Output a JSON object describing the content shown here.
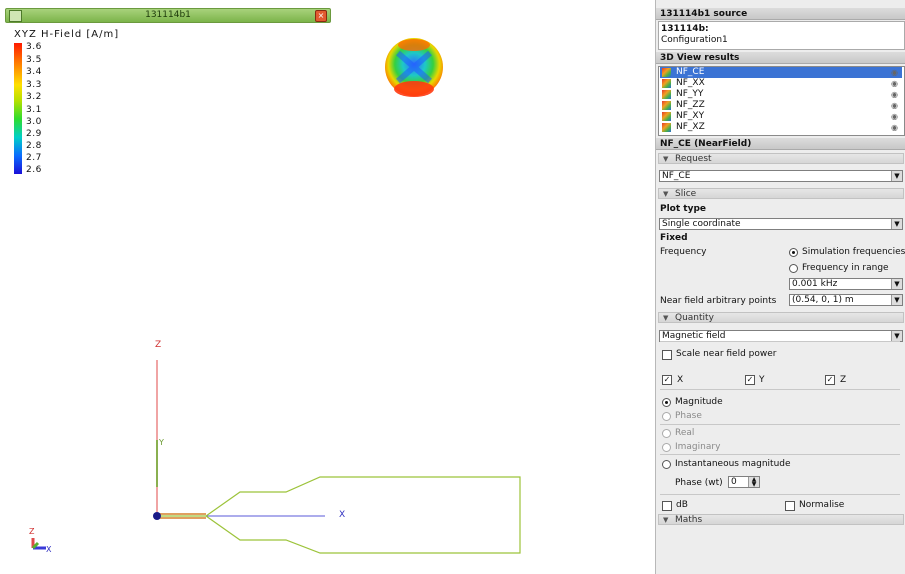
{
  "window": {
    "title": "131114b1",
    "legend_title": "XYZ H-Field [A/m]",
    "legend_ticks": [
      "3.6",
      "3.5",
      "3.4",
      "3.3",
      "3.2",
      "3.1",
      "3.0",
      "2.9",
      "2.8",
      "2.7",
      "2.6"
    ],
    "axis_labels": {
      "z": "Z",
      "y": "Y",
      "x": "X",
      "triad_z": "Z",
      "triad_x": "X"
    }
  },
  "panel": {
    "source_header": "131114b1 source",
    "source_name": "131114b:",
    "source_config": "Configuration1",
    "results_header": "3D View results",
    "results": [
      {
        "label": "NF_CE",
        "selected": true
      },
      {
        "label": "NF_XX",
        "selected": false
      },
      {
        "label": "NF_YY",
        "selected": false
      },
      {
        "label": "NF_ZZ",
        "selected": false
      },
      {
        "label": "NF_XY",
        "selected": false
      },
      {
        "label": "NF_XZ",
        "selected": false
      }
    ],
    "props_header": "NF_CE (NearField)",
    "request": {
      "section": "Request",
      "value": "NF_CE"
    },
    "slice": {
      "section": "Slice",
      "plot_type_label": "Plot type",
      "plot_type_value": "Single coordinate",
      "fixed_label": "Fixed",
      "frequency_label": "Frequency",
      "freq_option_sim": "Simulation frequencies",
      "freq_option_range": "Frequency in range",
      "freq_value": "0.001 kHz",
      "nf_points_label": "Near field arbitrary points",
      "nf_points_value": "(0.54, 0, 1) m"
    },
    "quantity": {
      "section": "Quantity",
      "value": "Magnetic field",
      "scale_label": "Scale near field power",
      "x_label": "X",
      "y_label": "Y",
      "z_label": "Z",
      "magnitude": "Magnitude",
      "phase": "Phase",
      "real": "Real",
      "imaginary": "Imaginary",
      "instantaneous": "Instantaneous magnitude",
      "phase_wt_label": "Phase (wt)",
      "phase_wt_value": "0",
      "db_label": "dB",
      "normalise_label": "Normalise"
    },
    "maths": {
      "section": "Maths"
    }
  }
}
